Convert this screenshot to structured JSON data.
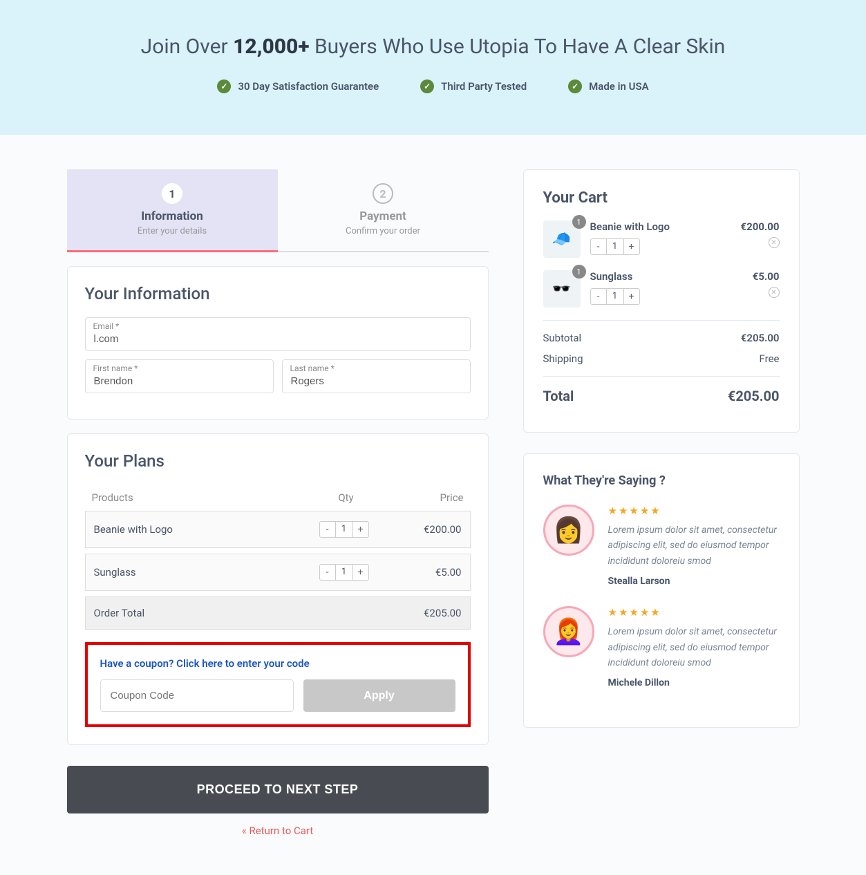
{
  "hero": {
    "title_pre": "Join Over ",
    "title_bold": "12,000+",
    "title_post": " Buyers Who Use Utopia To Have A Clear Skin",
    "badges": [
      "30 Day Satisfaction Guarantee",
      "Third Party Tested",
      "Made in USA"
    ]
  },
  "steps": [
    {
      "num": "1",
      "title": "Information",
      "sub": "Enter your details"
    },
    {
      "num": "2",
      "title": "Payment",
      "sub": "Confirm your order"
    }
  ],
  "info": {
    "heading": "Your Information",
    "email_label": "Email *",
    "email_value": "l.com",
    "first_label": "First name *",
    "first_value": "Brendon",
    "last_label": "Last name *",
    "last_value": "Rogers"
  },
  "plans": {
    "heading": "Your Plans",
    "col_products": "Products",
    "col_qty": "Qty",
    "col_price": "Price",
    "rows": [
      {
        "name": "Beanie with Logo",
        "qty": "1",
        "price": "€200.00"
      },
      {
        "name": "Sunglass",
        "qty": "1",
        "price": "€5.00"
      }
    ],
    "total_label": "Order Total",
    "total_value": "€205.00"
  },
  "coupon": {
    "link": "Have a coupon? Click here to enter your code",
    "placeholder": "Coupon Code",
    "apply": "Apply"
  },
  "proceed": "PROCEED TO NEXT STEP",
  "return": "« Return to Cart",
  "cart": {
    "title": "Your Cart",
    "items": [
      {
        "name": "Beanie with Logo",
        "badge": "1",
        "qty": "1",
        "price": "€200.00",
        "emoji": "🧢"
      },
      {
        "name": "Sunglass",
        "badge": "1",
        "qty": "1",
        "price": "€5.00",
        "emoji": "🕶️"
      }
    ],
    "subtotal_label": "Subtotal",
    "subtotal_value": "€205.00",
    "shipping_label": "Shipping",
    "shipping_value": "Free",
    "total_label": "Total",
    "total_value": "€205.00"
  },
  "testimonials": {
    "title": "What They're Saying ?",
    "items": [
      {
        "text": "Lorem ipsum dolor sit amet, consectetur adipiscing elit, sed do eiusmod tempor incididunt doloreiu smod",
        "author": "Stealla Larson",
        "emoji": "👩"
      },
      {
        "text": "Lorem ipsum dolor sit amet, consectetur adipiscing elit, sed do eiusmod tempor incididunt doloreiu smod",
        "author": "Michele Dillon",
        "emoji": "👩‍🦰"
      }
    ]
  }
}
